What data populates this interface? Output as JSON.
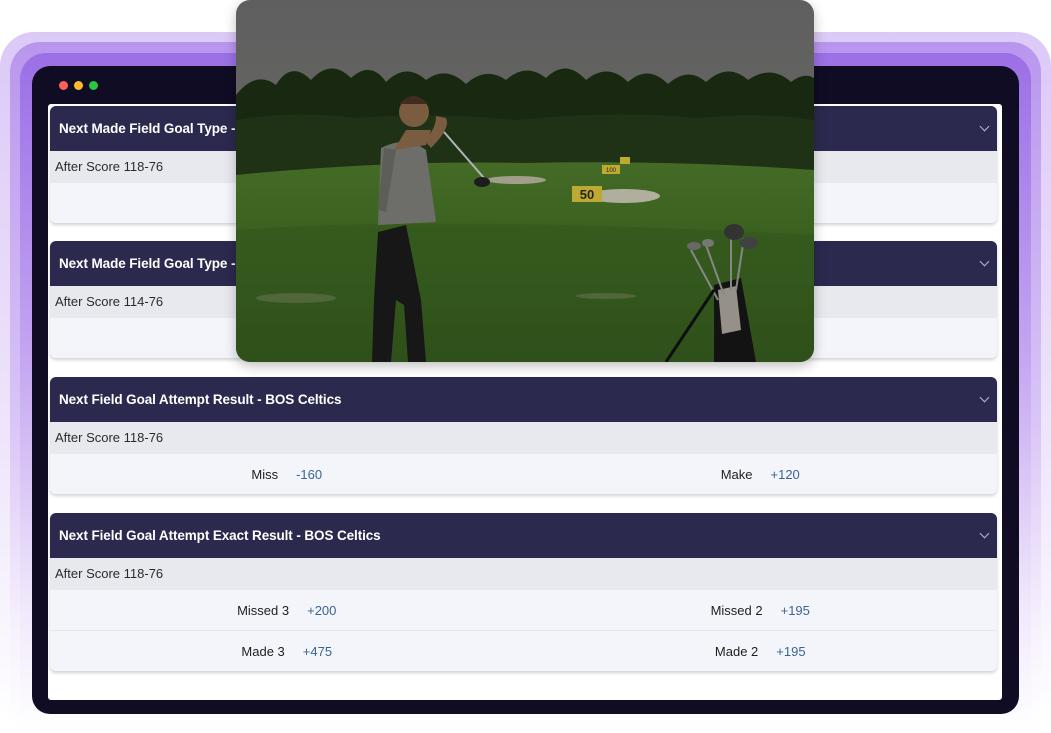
{
  "window_controls": [
    "close",
    "minimize",
    "maximize"
  ],
  "markets": [
    {
      "title": "Next Made Field Goal Type - B",
      "subtitle": "After Score 118-76",
      "rows": []
    },
    {
      "title": "Next Made Field Goal Type - G",
      "subtitle": "After Score 114-76",
      "rows": []
    },
    {
      "title": "Next Field Goal Attempt Result - BOS Celtics",
      "subtitle": "After Score 118-76",
      "rows": [
        [
          {
            "label": "Miss",
            "odds": "-160"
          },
          {
            "label": "Make",
            "odds": "+120"
          }
        ]
      ]
    },
    {
      "title": "Next Field Goal Attempt Exact Result - BOS Celtics",
      "subtitle": "After Score 118-76",
      "rows": [
        [
          {
            "label": "Missed 3",
            "odds": "+200"
          },
          {
            "label": "Missed 2",
            "odds": "+195"
          }
        ],
        [
          {
            "label": "Made 3",
            "odds": "+475"
          },
          {
            "label": "Made 2",
            "odds": "+195"
          }
        ]
      ]
    }
  ],
  "photo": {
    "subject": "golfer-swinging-on-driving-range",
    "sign_text": "50",
    "sign_text_2": "100"
  },
  "colors": {
    "header_bg": "#2b2a4e",
    "subheader_bg": "#e8e9ee",
    "odds": "#3b6493",
    "frame_glow": "#9b6fe6"
  }
}
